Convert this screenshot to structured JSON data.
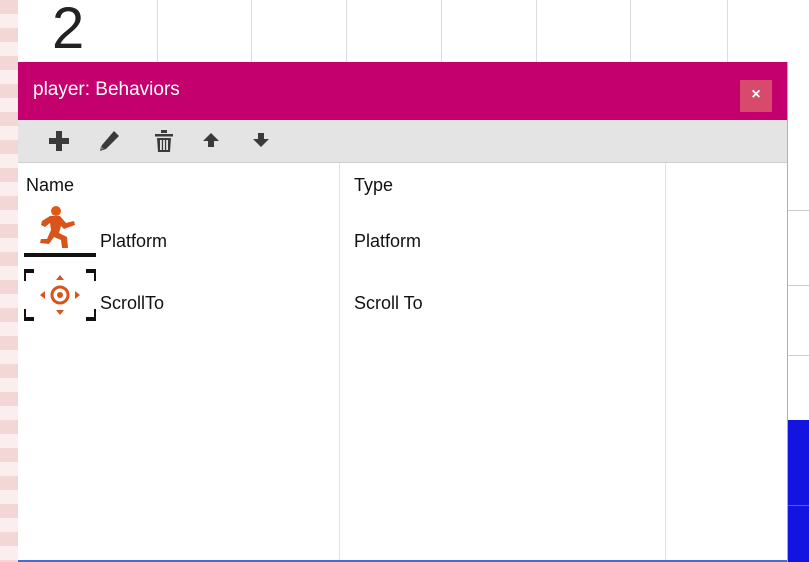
{
  "background": {
    "label": "2",
    "stripe_color": "#f3d6d6",
    "selection_color": "#1414e0"
  },
  "dialog": {
    "title": "player: Behaviors",
    "close_label": "×",
    "titlebar_color": "#c4006f"
  },
  "toolbar": {
    "buttons": [
      {
        "name": "add",
        "icon": "plus-icon"
      },
      {
        "name": "edit",
        "icon": "pencil-icon"
      },
      {
        "name": "delete",
        "icon": "trash-icon"
      },
      {
        "name": "move-up",
        "icon": "arrow-up-icon"
      },
      {
        "name": "move-down",
        "icon": "arrow-down-icon"
      }
    ]
  },
  "list": {
    "columns": [
      "Name",
      "Type"
    ],
    "rows": [
      {
        "name": "Platform",
        "type": "Platform",
        "icon": "platform-runner-icon"
      },
      {
        "name": "ScrollTo",
        "type": "Scroll To",
        "icon": "scroll-to-target-icon"
      }
    ]
  }
}
